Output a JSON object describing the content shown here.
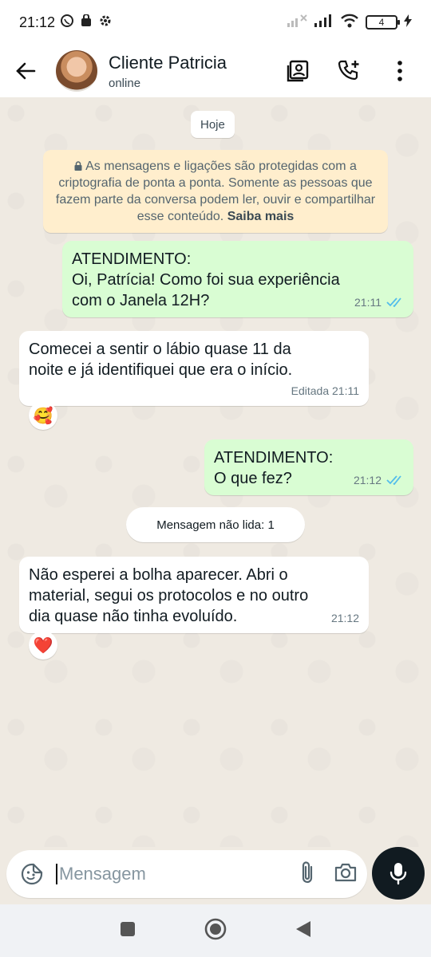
{
  "statusbar": {
    "time": "21:12",
    "battery": "4"
  },
  "header": {
    "name": "Cliente Patricia",
    "status": "online"
  },
  "chat": {
    "date_chip": "Hoje",
    "security_notice": "As mensagens e ligações são protegidas com a criptografia de ponta a ponta. Somente as pessoas que fazem parte da conversa podem ler, ouvir e compartilhar esse conteúdo.",
    "security_link": "Saiba mais",
    "messages": [
      {
        "direction": "out",
        "lines": [
          "ATENDIMENTO:",
          "Oi, Patrícia! Como foi sua experiência",
          "com o Janela 12H?"
        ],
        "time": "21:11"
      },
      {
        "direction": "in",
        "lines": [
          "Comecei a sentir o lábio quase 11 da",
          "noite e já identifiquei que era o início."
        ],
        "time": "Editada 21:11",
        "reaction": "🥰"
      },
      {
        "direction": "out",
        "lines": [
          "ATENDIMENTO:",
          "O que fez?"
        ],
        "time": "21:12"
      },
      {
        "direction": "in",
        "lines": [
          "Não esperei a bolha aparecer. Abri o",
          "material, segui os protocolos e no outro",
          "dia quase não tinha evoluído."
        ],
        "time": "21:12",
        "reaction": "❤️"
      }
    ],
    "unread_chip": "Mensagem não lida: 1"
  },
  "composer": {
    "placeholder": "Mensagem"
  },
  "colors": {
    "accent": "#53bdeb",
    "outgoing": "#d9fdd3",
    "notice": "#ffeecd"
  }
}
